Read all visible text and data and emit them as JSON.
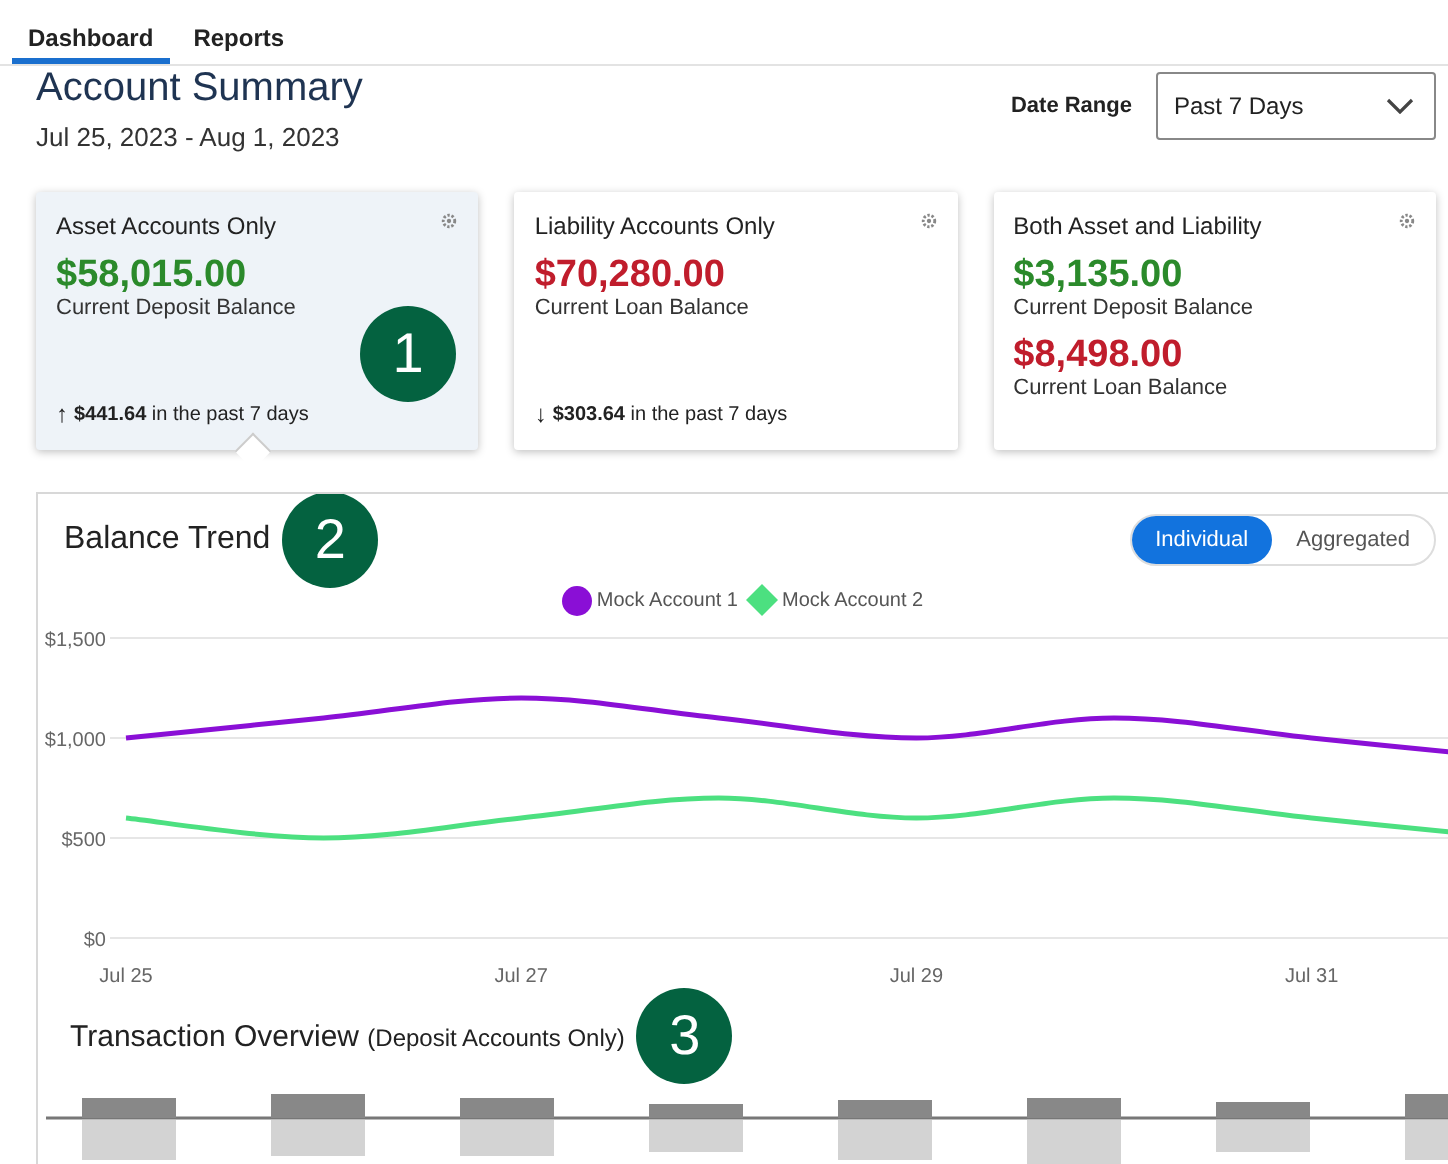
{
  "tabs": [
    {
      "label": "Dashboard",
      "selected": true
    },
    {
      "label": "Reports",
      "selected": false
    }
  ],
  "header": {
    "title": "Account Summary",
    "dates": "Jul 25, 2023 - Aug 1, 2023",
    "date_range": {
      "label": "Date Range",
      "value": "Past 7 Days"
    }
  },
  "cards": [
    {
      "title": "Asset Accounts Only",
      "selected": true,
      "callout": "1",
      "balances": [
        {
          "amount": "$58,015.00",
          "kind": "deposit",
          "caption": "Current Deposit Balance"
        }
      ],
      "change": {
        "arrow": "↑",
        "amount": "$441.64",
        "text": "in the past 7 days"
      }
    },
    {
      "title": "Liability Accounts Only",
      "selected": false,
      "balances": [
        {
          "amount": "$70,280.00",
          "kind": "loan",
          "caption": "Current Loan Balance"
        }
      ],
      "change": {
        "arrow": "↓",
        "amount": "$303.64",
        "text": "in the past 7 days"
      }
    },
    {
      "title": "Both Asset and Liability",
      "selected": false,
      "balances": [
        {
          "amount": "$3,135.00",
          "kind": "deposit",
          "caption": "Current Deposit Balance"
        },
        {
          "amount": "$8,498.00",
          "kind": "loan",
          "caption": "Current Loan Balance"
        }
      ]
    }
  ],
  "balance_trend": {
    "title": "Balance Trend",
    "callout": "2",
    "toggle": [
      {
        "label": "Individual",
        "selected": true
      },
      {
        "label": "Aggregated",
        "selected": false
      }
    ],
    "chart_data": {
      "type": "line",
      "categories": [
        "Jul 25",
        null,
        "Jul 27",
        null,
        "Jul 29",
        null,
        "Jul 31"
      ],
      "ylim": [
        0,
        1500
      ],
      "yticks": [
        {
          "value": 0,
          "label": "$0"
        },
        {
          "value": 500,
          "label": "$500"
        },
        {
          "value": 1000,
          "label": "$1,000"
        },
        {
          "value": 1500,
          "label": "$1,500"
        }
      ],
      "series": [
        {
          "name": "Mock Account 1",
          "color": "#8a0fd6",
          "values": [
            1000,
            1100,
            1200,
            1100,
            1000,
            1100,
            1000
          ]
        },
        {
          "name": "Mock Account 2",
          "color": "#4ce080",
          "values": [
            600,
            500,
            600,
            700,
            600,
            700,
            600
          ]
        }
      ]
    }
  },
  "transactions": {
    "title": "Transaction Overview",
    "subtitle": "(Deposit Accounts Only)",
    "callout": "3"
  }
}
